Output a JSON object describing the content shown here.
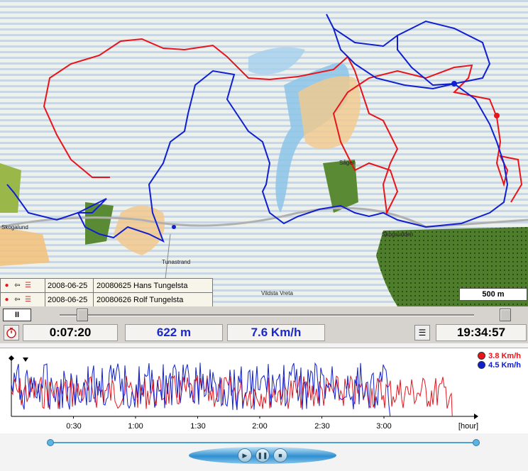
{
  "tracks": [
    {
      "date": "2008-06-25",
      "name": "20080625 Hans Tungelsta",
      "color": "#e8141c"
    },
    {
      "date": "2008-06-25",
      "name": "20080626 Rolf Tungelsta",
      "color": "#1020d0"
    }
  ],
  "map": {
    "scale_label": "500 m",
    "place_labels": [
      "Skogalund",
      "Tunastrand",
      "Vildsta Vreta",
      "Sågen",
      "Skogsudden"
    ]
  },
  "playback": {
    "pause_label": "II",
    "position_fraction": 0.03,
    "end_fraction": 1.0
  },
  "status": {
    "elapsed": "0:07:20",
    "distance": "622 m",
    "speed": "7.6 Km/h",
    "clock": "19:34:57"
  },
  "graph": {
    "legend": [
      {
        "label": "3.8 Km/h",
        "color": "#e8141c"
      },
      {
        "label": "4.5 Km/h",
        "color": "#1020d0"
      }
    ],
    "x_ticks": [
      "0:30",
      "1:00",
      "1:30",
      "2:00",
      "2:30",
      "3:00",
      "[hour]"
    ]
  },
  "controls": {
    "play_icon": "play-icon",
    "pause_icon": "pause-icon",
    "stop_icon": "stop-icon"
  },
  "chart_data": {
    "type": "line",
    "xlabel": "[hour]",
    "series": [
      {
        "name": "3.8 Km/h",
        "color": "#e8141c",
        "x_end_hours": 3.55
      },
      {
        "name": "4.5 Km/h",
        "color": "#1020d0",
        "x_end_hours": 3.05
      }
    ]
  }
}
